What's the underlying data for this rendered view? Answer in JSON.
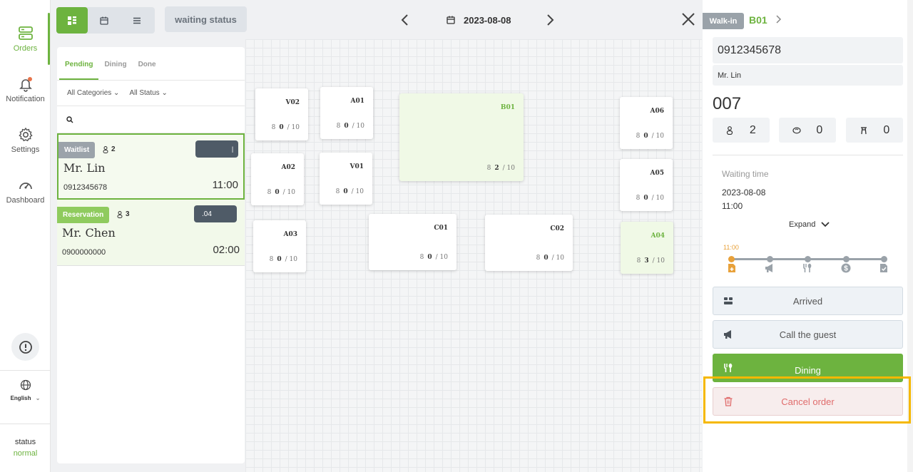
{
  "nav": {
    "items": [
      {
        "label": "Orders",
        "icon": "orders-icon"
      },
      {
        "label": "Notification",
        "icon": "bell-icon"
      },
      {
        "label": "Settings",
        "icon": "gear-icon"
      },
      {
        "label": "Dashboard",
        "icon": "gauge-icon"
      }
    ],
    "language": "English",
    "status_label": "status",
    "status_value": "normal"
  },
  "toolbar": {
    "waiting_status": "waiting status",
    "date": "2023-08-08"
  },
  "list": {
    "tabs": [
      "Pending",
      "Dining",
      "Done"
    ],
    "filters": [
      "All Categories",
      "All Status"
    ],
    "orders": [
      {
        "tag": "Waitlist",
        "guests": "2",
        "pill": "",
        "name": "Mr. Lin",
        "phone": "0912345678",
        "time": "11:00"
      },
      {
        "tag": "Reservation",
        "guests": "3",
        "pill": ".04",
        "name": "Mr. Chen",
        "phone": "0900000000",
        "time": "02:00"
      }
    ]
  },
  "tables": [
    {
      "name": "V02",
      "count": "0",
      "capacity": "/ 10"
    },
    {
      "name": "A01",
      "count": "0",
      "capacity": "/ 10"
    },
    {
      "name": "B01",
      "count": "2",
      "capacity": "/ 10"
    },
    {
      "name": "A06",
      "count": "0",
      "capacity": "/ 10"
    },
    {
      "name": "A02",
      "count": "0",
      "capacity": "/ 10"
    },
    {
      "name": "V01",
      "count": "0",
      "capacity": "/ 10"
    },
    {
      "name": "A05",
      "count": "0",
      "capacity": "/ 10"
    },
    {
      "name": "A03",
      "count": "0",
      "capacity": "/ 10"
    },
    {
      "name": "C01",
      "count": "0",
      "capacity": "/ 10"
    },
    {
      "name": "C02",
      "count": "0",
      "capacity": "/ 10"
    },
    {
      "name": "A04",
      "count": "3",
      "capacity": "/ 10"
    }
  ],
  "detail": {
    "type": "Walk-in",
    "table": "B01",
    "phone": "0912345678",
    "name": "Mr. Lin",
    "order_no": "007",
    "adults": "2",
    "children": "0",
    "high_chairs": "0",
    "waiting_label": "Waiting time",
    "waiting_date": "2023-08-08",
    "waiting_time": "11:00",
    "expand": "Expand",
    "timeline_time": "11:00",
    "actions": {
      "arrived": "Arrived",
      "call": "Call the guest",
      "dining": "Dining",
      "cancel": "Cancel order"
    }
  },
  "colors": {
    "accent": "#6db33f",
    "danger": "#e06c6c",
    "highlight": "#f5b800"
  }
}
